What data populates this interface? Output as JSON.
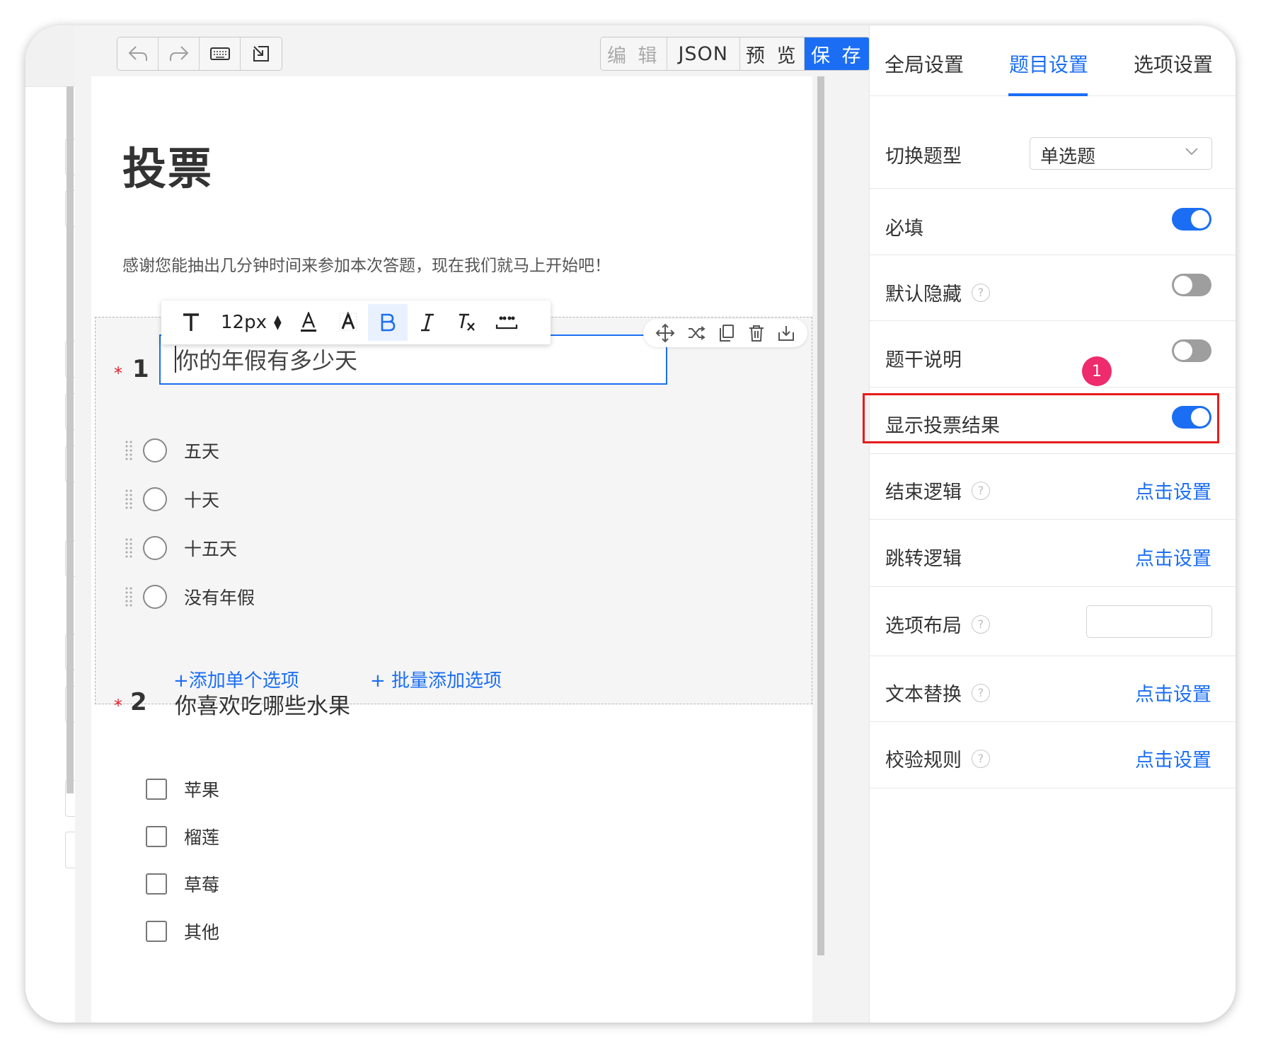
{
  "toolbar": {
    "mode_buttons": [
      "编 辑",
      "JSON",
      "预 览",
      "保 存"
    ]
  },
  "survey": {
    "title": "投票",
    "description": "感谢您能抽出几分钟时间来参加本次答题，现在我们就马上开始吧！"
  },
  "format_bar": {
    "font_size": "12px"
  },
  "question1": {
    "required_mark": "*",
    "number": "1",
    "title": "你的年假有多少天",
    "options": [
      "五天",
      "十天",
      "十五天",
      "没有年假"
    ],
    "add_single": "+添加单个选项",
    "add_batch": "+ 批量添加选项"
  },
  "question2": {
    "required_mark": "*",
    "number": "2",
    "title": "你喜欢吃哪些水果",
    "options": [
      "苹果",
      "榴莲",
      "草莓",
      "其他"
    ]
  },
  "right_panel": {
    "tabs": [
      "全局设置",
      "题目设置",
      "选项设置"
    ],
    "active_tab": "题目设置",
    "switch_type_label": "切换题型",
    "switch_type_value": "单选题",
    "required_label": "必填",
    "default_hidden_label": "默认隐藏",
    "stem_desc_label": "题干说明",
    "show_result_label": "显示投票结果",
    "end_logic_label": "结束逻辑",
    "jump_logic_label": "跳转逻辑",
    "option_layout_label": "选项布局",
    "text_replace_label": "文本替换",
    "validate_label": "校验规则",
    "click_set": "点击设置",
    "help_glyph": "?",
    "toggles": {
      "required": true,
      "default_hidden": false,
      "stem_desc": false,
      "show_result": true
    }
  },
  "annotation": {
    "badge": "1"
  },
  "colors": {
    "accent": "#1b6ef3",
    "highlight": "#e61b1b",
    "badge": "#ee2b6c",
    "required": "#e3212b"
  }
}
